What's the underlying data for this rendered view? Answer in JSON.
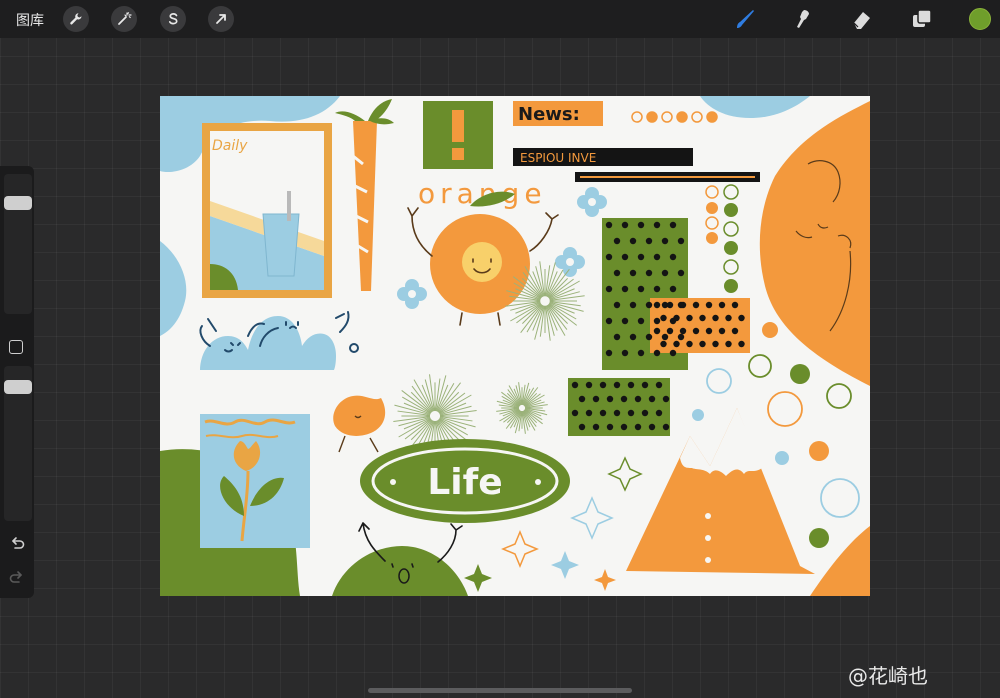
{
  "toolbar": {
    "gallery_label": "图库",
    "left_icons": [
      "wrench-icon",
      "magic-wand-icon",
      "selection-s-icon",
      "transform-arrow-icon"
    ],
    "right_icons": [
      "brush-icon",
      "smudge-icon",
      "eraser-icon",
      "layers-icon"
    ],
    "current_color": "#6f9e2b",
    "active_tool_color": "#2f7de1"
  },
  "sidebar": {
    "icons": [
      "modify-square-icon",
      "undo-icon",
      "redo-icon"
    ]
  },
  "canvas": {
    "texts": {
      "daily": "Daily",
      "news": "News:",
      "espiou": "ESPIOU INVE",
      "orange": "orange",
      "life": "Life"
    },
    "colors": {
      "orange": "#f3993d",
      "green": "#6a8d2b",
      "blue": "#9ccde2",
      "cream": "#f6f6f4"
    }
  },
  "watermark": {
    "text": "@花崎也"
  }
}
